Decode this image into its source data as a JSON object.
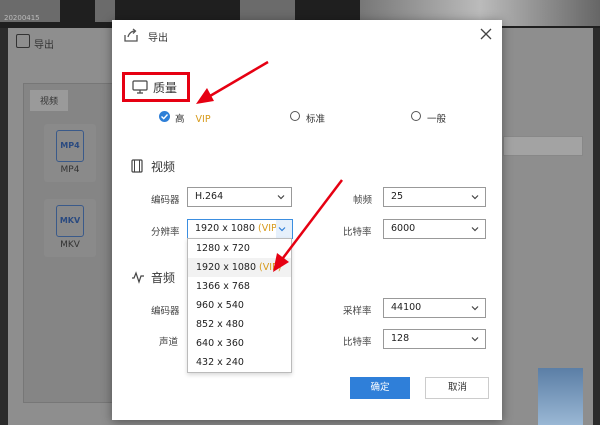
{
  "background": {
    "top_text": "20200415",
    "dialog_title": "导出",
    "tab_video": "视频",
    "formats": [
      {
        "icon": "MP4",
        "label": "MP4"
      },
      {
        "icon": "MKV",
        "label": "MKV"
      }
    ]
  },
  "dialog": {
    "title": "导出",
    "close_icon": "close-icon",
    "quality": {
      "label": "质量",
      "options": [
        {
          "label": "高",
          "vip": "VIP",
          "checked": true
        },
        {
          "label": "标准",
          "checked": false
        },
        {
          "label": "一般",
          "checked": false
        }
      ]
    },
    "video": {
      "label": "视频",
      "encoder_label": "编码器",
      "encoder_value": "H.264",
      "framerate_label": "帧频",
      "framerate_value": "25",
      "resolution_label": "分辨率",
      "resolution_value": "1920 x 1080",
      "resolution_vip": "(VIP)",
      "bitrate_label": "比特率",
      "bitrate_value": "6000"
    },
    "audio": {
      "label": "音频",
      "encoder_label": "编码器",
      "samplerate_label": "采样率",
      "samplerate_value": "44100",
      "channel_label": "声道",
      "bitrate_label": "比特率",
      "bitrate_value": "128"
    },
    "resolution_options": [
      {
        "text": "1280 x 720",
        "vip": ""
      },
      {
        "text": "1920 x 1080",
        "vip": "(VIP)"
      },
      {
        "text": "1366 x 768",
        "vip": ""
      },
      {
        "text": "960 x 540",
        "vip": ""
      },
      {
        "text": "852 x 480",
        "vip": ""
      },
      {
        "text": "640 x 360",
        "vip": ""
      },
      {
        "text": "432 x 240",
        "vip": ""
      }
    ],
    "ok_label": "确定",
    "cancel_label": "取消"
  },
  "colors": {
    "accent": "#2f7fd9",
    "vip": "#d79a1a",
    "annotation": "#e60012"
  }
}
